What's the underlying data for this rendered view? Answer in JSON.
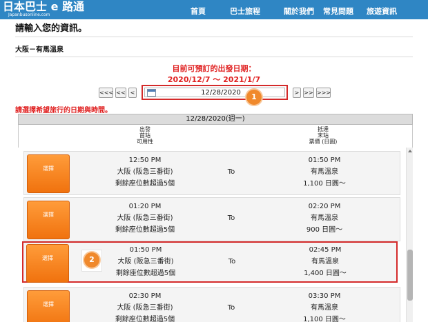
{
  "header": {
    "logo_main": "日本巴士 e 路通",
    "logo_sub": "Japanbusonline.com",
    "nav": [
      "首頁",
      "巴士旅程",
      "關於我們",
      "常見問題",
      "旅遊資訊"
    ]
  },
  "page": {
    "title": "請輸入您的資訊。",
    "route": "大阪－有馬溫泉"
  },
  "date_section": {
    "caption_line1": "目前可預訂的出發日期：",
    "caption_line2": "2020/12/7 ～ 2021/1/7",
    "nav_buttons": [
      "<<<",
      "<<",
      "<",
      ">",
      ">>",
      ">>>"
    ],
    "date_value": "12/28/2020",
    "badge_1": "1",
    "prompt": "請選擇希望旅行的日期與時間。"
  },
  "timetable": {
    "date_header": "12/28/2020(週一)",
    "depart_head": [
      "出發",
      "首站",
      "可用性"
    ],
    "arrive_head": [
      "抵達",
      "末站",
      "票價 (日圓)"
    ],
    "select_label": "選擇",
    "to_label": "To",
    "badge_2": "2",
    "rows": [
      {
        "dep_time": "12:50 PM",
        "dep_stop": "大阪 (阪急三番街)",
        "availability": "剩餘座位數超過5個",
        "arr_time": "01:50 PM",
        "arr_stop": "有馬溫泉",
        "fare": "1,100 日圓～"
      },
      {
        "dep_time": "01:20 PM",
        "dep_stop": "大阪 (阪急三番街)",
        "availability": "剩餘座位數超過5個",
        "arr_time": "02:20 PM",
        "arr_stop": "有馬溫泉",
        "fare": "900 日圓～"
      },
      {
        "dep_time": "01:50 PM",
        "dep_stop": "大阪 (阪急三番街)",
        "availability": "剩餘座位數超過5個",
        "arr_time": "02:45 PM",
        "arr_stop": "有馬溫泉",
        "fare": "1,400 日圓～"
      },
      {
        "dep_time": "02:30 PM",
        "dep_stop": "大阪 (阪急三番街)",
        "availability": "剩餘座位數超過5個",
        "arr_time": "03:30 PM",
        "arr_stop": "有馬溫泉",
        "fare": "1,100 日圓～"
      }
    ]
  },
  "colors": {
    "header_bg": "#2f86c4",
    "accent_red": "#e02020",
    "select_orange": "#f0720e",
    "badge_orange": "#f0892c"
  }
}
